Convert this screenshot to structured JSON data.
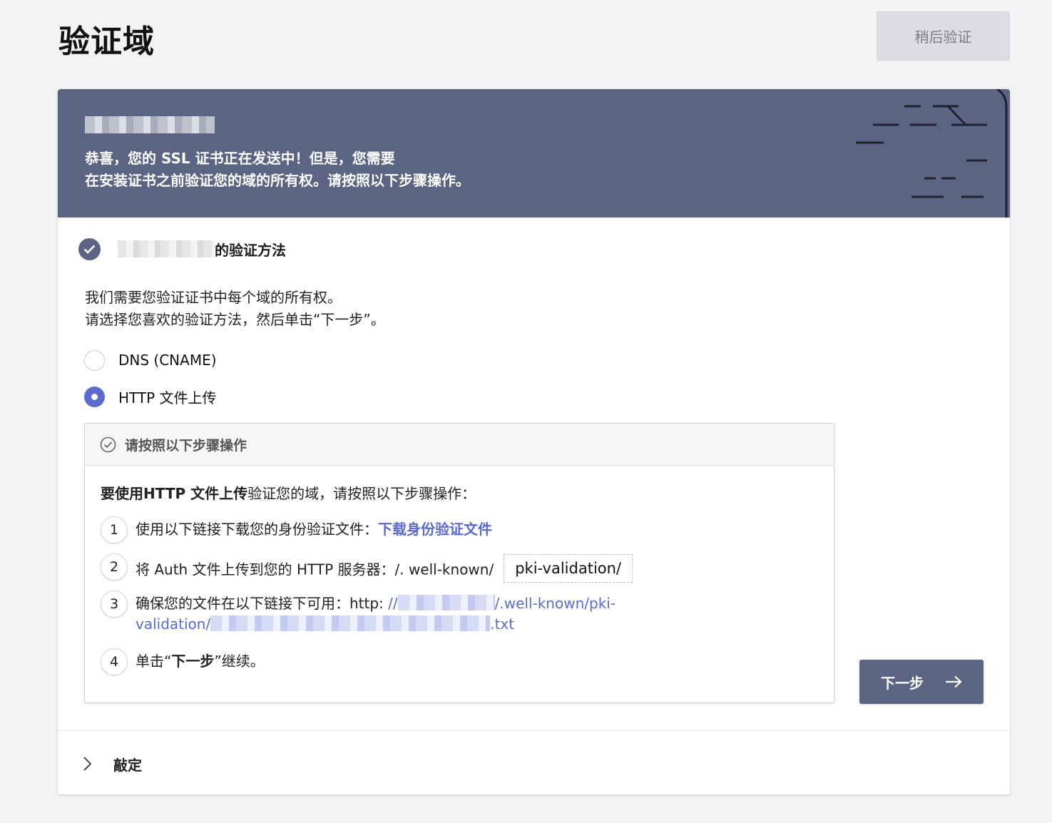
{
  "header": {
    "title": "验证域",
    "later_button": "稍后验证"
  },
  "banner": {
    "domain_redacted": "[redacted]",
    "line1": "恭喜，您的 SSL 证书正在发送中！但是，您需要",
    "line2": "在安装证书之前验证您的域的所有权。请按照以下步骤操作。"
  },
  "method_section": {
    "title_suffix": "的验证方法",
    "intro_line1": "我们需要您验证证书中每个域的所有权。",
    "intro_line2": "请选择您喜欢的验证方法，然后单击“下一步”。",
    "options": [
      {
        "label": "DNS (CNAME)",
        "selected": false
      },
      {
        "label": "HTTP 文件上传",
        "selected": true
      }
    ]
  },
  "steps": {
    "header": "请按照以下步骤操作",
    "lead_bold": "要使用HTTP 文件上传",
    "lead_rest": "验证您的域，请按照以下步骤操作：",
    "items": [
      {
        "num": "1",
        "text": "使用以下链接下载您的身份验证文件：",
        "link": "下载身份验证文件"
      },
      {
        "num": "2",
        "text": "将 Auth 文件上传到您的 HTTP 服务器：/. well-known/",
        "path": "pki-validation/"
      },
      {
        "num": "3",
        "text": "确保您的文件在以下链接下可用：http:",
        "url_start": " //",
        "url_mid": "/.well-known/pki-",
        "url_line2_start": "validation/",
        "url_end": ".txt"
      },
      {
        "num": "4",
        "text_before": "单击“",
        "text_bold": "下一步",
        "text_after": "”继续。"
      }
    ]
  },
  "next_button": "下一步",
  "finalize": {
    "label": "敲定"
  },
  "colors": {
    "banner": "#5b6482",
    "accent": "#5a6ad0"
  }
}
